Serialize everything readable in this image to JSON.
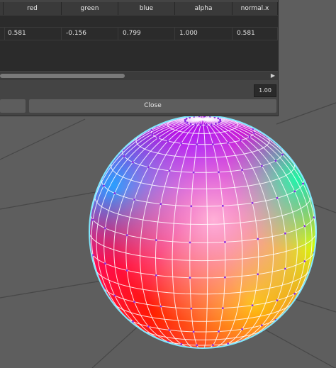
{
  "table": {
    "headers": [
      "",
      "red",
      "green",
      "blue",
      "alpha",
      "normal.x"
    ],
    "rows": [
      [
        "",
        "0.581",
        "-0.156",
        "0.799",
        "1.000",
        "0.581"
      ]
    ]
  },
  "value_field": "1.00",
  "buttons": {
    "close": "Close"
  },
  "sphere": {
    "colors": {
      "top": "#9a00ff",
      "top_left": "#3399ff",
      "left": "#ff00ff",
      "center": "#ff0066",
      "bottom": "#ff2000",
      "bottom_right": "#ffb000",
      "right": "#e8ff00",
      "upper_right": "#00ff88",
      "wire": "#7fe8ff"
    }
  },
  "icons": {
    "scroll_right": "triangle-right-icon"
  }
}
